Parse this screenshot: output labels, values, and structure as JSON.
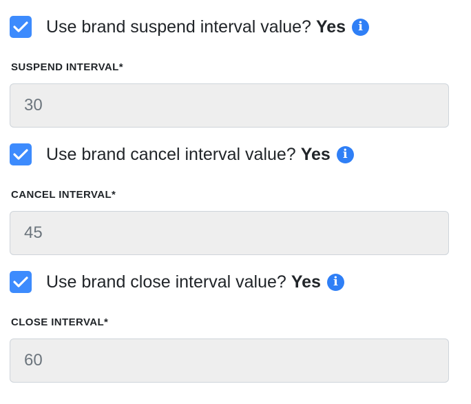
{
  "fields": [
    {
      "checkbox_checked": true,
      "checkbox_text": "Use brand suspend interval value?",
      "checkbox_value": "Yes",
      "info_icon": "info-circle-icon",
      "label": "SUSPEND INTERVAL*",
      "value": "30"
    },
    {
      "checkbox_checked": true,
      "checkbox_text": "Use brand cancel interval value?",
      "checkbox_value": "Yes",
      "info_icon": "info-circle-icon",
      "label": "CANCEL INTERVAL*",
      "value": "45"
    },
    {
      "checkbox_checked": true,
      "checkbox_text": "Use brand close interval value?",
      "checkbox_value": "Yes",
      "info_icon": "info-circle-icon",
      "label": "CLOSE INTERVAL*",
      "value": "60"
    }
  ],
  "colors": {
    "checkbox": "#3d8bfd",
    "info_icon": "#2f7ff6",
    "input_background": "#eeeeee",
    "input_text": "#6c757d"
  }
}
